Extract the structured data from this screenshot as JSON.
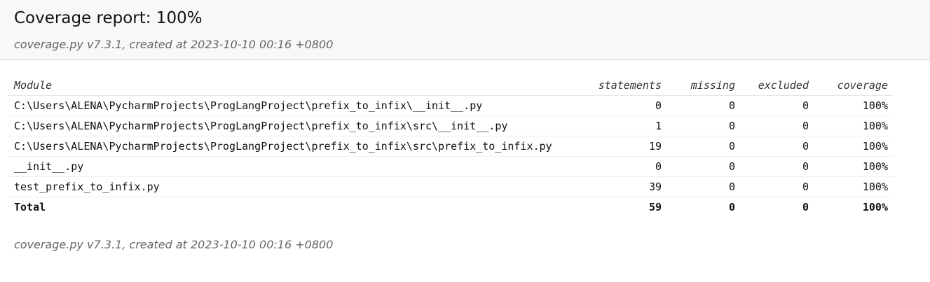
{
  "header": {
    "title": "Coverage report: 100%",
    "meta": "coverage.py v7.3.1, created at 2023-10-10 00:16 +0800"
  },
  "table": {
    "columns": [
      "Module",
      "statements",
      "missing",
      "excluded",
      "coverage"
    ],
    "rows": [
      {
        "module": "C:\\Users\\ALENA\\PycharmProjects\\ProgLangProject\\prefix_to_infix\\__init__.py",
        "statements": "0",
        "missing": "0",
        "excluded": "0",
        "coverage": "100%"
      },
      {
        "module": "C:\\Users\\ALENA\\PycharmProjects\\ProgLangProject\\prefix_to_infix\\src\\__init__.py",
        "statements": "1",
        "missing": "0",
        "excluded": "0",
        "coverage": "100%"
      },
      {
        "module": "C:\\Users\\ALENA\\PycharmProjects\\ProgLangProject\\prefix_to_infix\\src\\prefix_to_infix.py",
        "statements": "19",
        "missing": "0",
        "excluded": "0",
        "coverage": "100%"
      },
      {
        "module": "__init__.py",
        "statements": "0",
        "missing": "0",
        "excluded": "0",
        "coverage": "100%"
      },
      {
        "module": "test_prefix_to_infix.py",
        "statements": "39",
        "missing": "0",
        "excluded": "0",
        "coverage": "100%"
      }
    ],
    "total": {
      "module": "Total",
      "statements": "59",
      "missing": "0",
      "excluded": "0",
      "coverage": "100%"
    }
  },
  "footer": {
    "meta": "coverage.py v7.3.1, created at 2023-10-10 00:16 +0800"
  }
}
